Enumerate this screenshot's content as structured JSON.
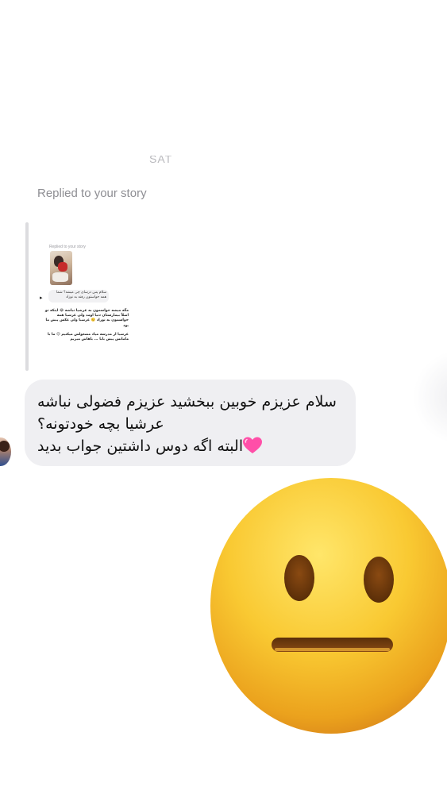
{
  "thread": {
    "cut_off_time": "SAT",
    "replied_label": "Replied to your story",
    "story_preview": {
      "replied_label": "Replied to your story",
      "bubble_text": "سلام پس درسای چی میشه؟ شما همه حواستون رفته به نوزاد",
      "text_block_1": "مگه میشه حواسمون به عرشیا نباشه 😂 اینکه تو اصلاً بیمارستان دنیا اومد ولی عرشیا همه حواسمون به نوزاد ☺️ عرشیا ولی عکس پیش ما بود",
      "text_block_2": "عرشیا از مدرسه میاد مشغولش میکنیم 😊 ما با مامانش پیش بابا ... باهاش میریم"
    },
    "message": {
      "line1": "سلام عزیزم خوبین ببخشید عزیزم فضولی نباشه",
      "line2": "عرشیا بچه خودتونه؟",
      "line3": "البته اگه دوس داشتین جواب بدید",
      "heart_icon": "pink-heart-emoji"
    },
    "sticker_icon": "neutral-face-emoji",
    "colors": {
      "bubble_bg": "#efeff2",
      "label_gray": "#8e8e93",
      "heart_pink": "#ff4fa8",
      "emoji_yellow": "#f7c22a"
    }
  }
}
